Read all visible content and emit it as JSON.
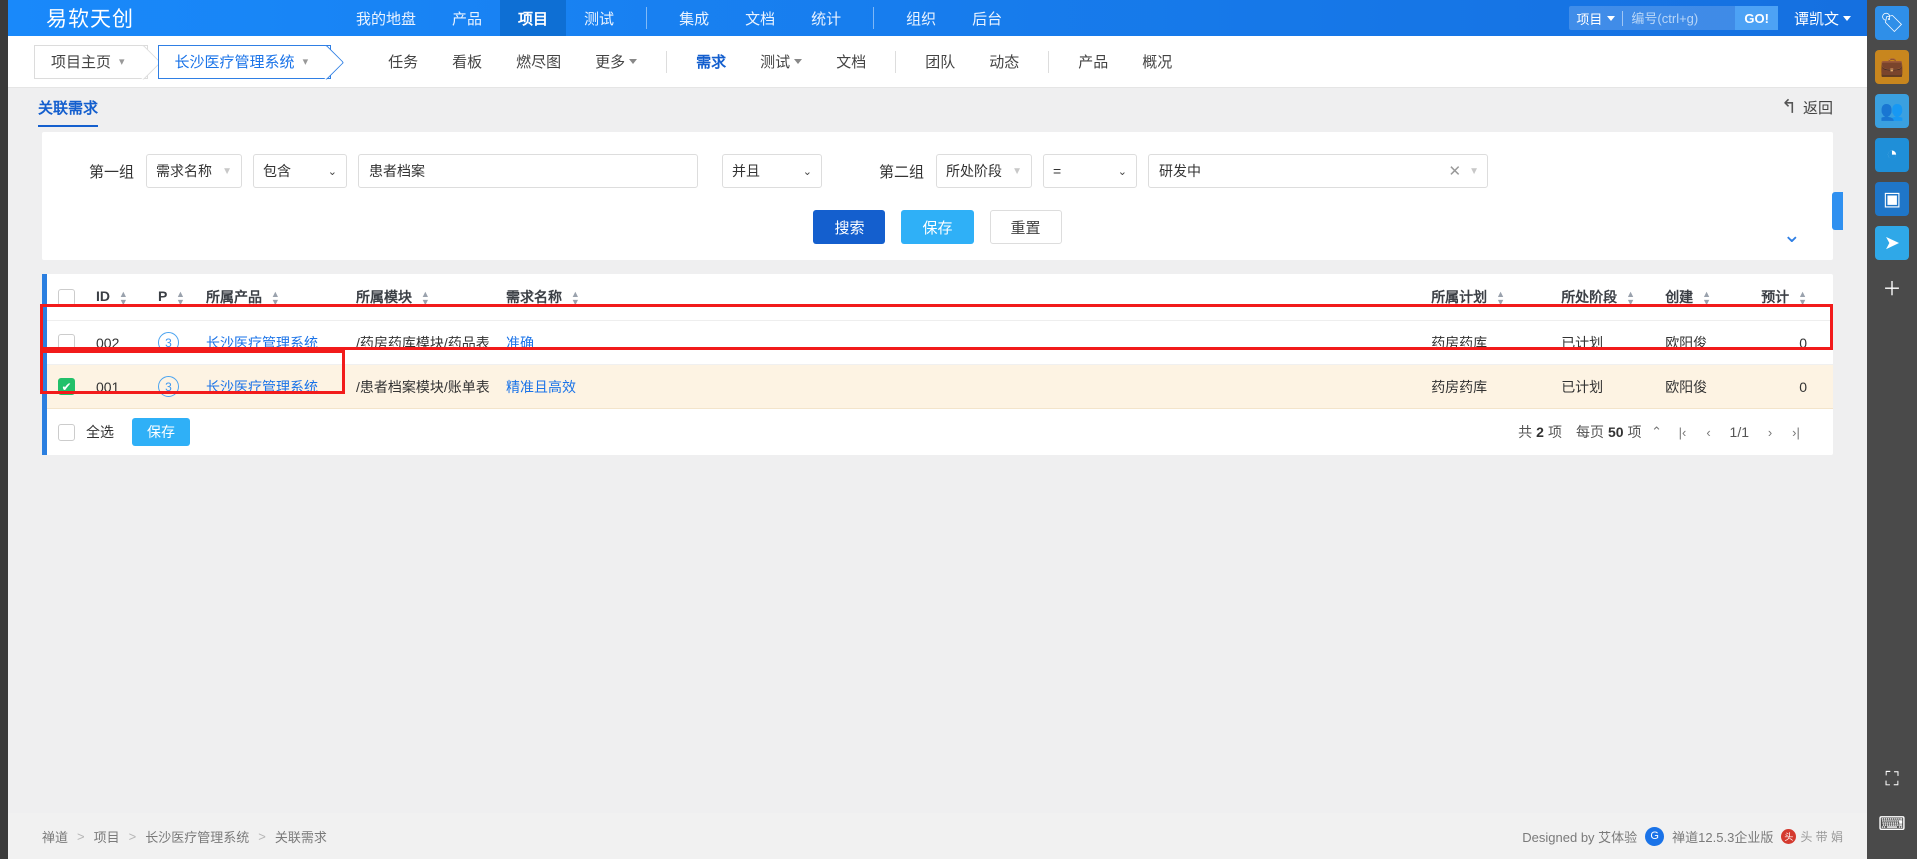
{
  "brand": "易软天创",
  "topnav": {
    "items": [
      {
        "label": "我的地盘",
        "active": false
      },
      {
        "label": "产品",
        "active": false
      },
      {
        "label": "项目",
        "active": true
      },
      {
        "label": "测试",
        "active": false
      },
      {
        "divider": true
      },
      {
        "label": "集成",
        "active": false
      },
      {
        "label": "文档",
        "active": false
      },
      {
        "label": "统计",
        "active": false
      },
      {
        "divider": true
      },
      {
        "label": "组织",
        "active": false
      },
      {
        "label": "后台",
        "active": false
      }
    ],
    "search": {
      "type": "项目",
      "placeholder": "编号(ctrl+g)",
      "value": "",
      "go_label": "GO!"
    },
    "user": "谭凯文"
  },
  "breadcrumbs": [
    {
      "label": "项目主页",
      "type": "plain"
    },
    {
      "label": "长沙医疗管理系统",
      "type": "project"
    }
  ],
  "subnav": {
    "items": [
      {
        "label": "任务",
        "active": false,
        "caret": false
      },
      {
        "label": "看板",
        "active": false,
        "caret": false
      },
      {
        "label": "燃尽图",
        "active": false,
        "caret": false
      },
      {
        "label": "更多",
        "active": false,
        "caret": true
      },
      {
        "divider": true
      },
      {
        "label": "需求",
        "active": true,
        "caret": false
      },
      {
        "label": "测试",
        "active": false,
        "caret": true
      },
      {
        "label": "文档",
        "active": false,
        "caret": false
      },
      {
        "divider": true
      },
      {
        "label": "团队",
        "active": false,
        "caret": false
      },
      {
        "label": "动态",
        "active": false,
        "caret": false
      },
      {
        "divider": true
      },
      {
        "label": "产品",
        "active": false,
        "caret": false
      },
      {
        "label": "概况",
        "active": false,
        "caret": false
      }
    ]
  },
  "page": {
    "tab": "关联需求",
    "back_label": "返回"
  },
  "filters": {
    "group1_label": "第一组",
    "group1_field": "需求名称",
    "group1_operator": "包含",
    "group1_value": "患者档案",
    "group1_value_placeholder": "",
    "conjunction": "并且",
    "group2_label": "第二组",
    "group2_field": "所处阶段",
    "group2_operator": "=",
    "group2_value": "研发中",
    "buttons": {
      "search": "搜索",
      "save": "保存",
      "reset": "重置"
    }
  },
  "table": {
    "columns": [
      {
        "key": "checkbox",
        "label": "",
        "sortable": false
      },
      {
        "key": "id",
        "label": "ID",
        "sortable": true
      },
      {
        "key": "pri",
        "label": "P",
        "sortable": true
      },
      {
        "key": "product",
        "label": "所属产品",
        "sortable": true
      },
      {
        "key": "module",
        "label": "所属模块",
        "sortable": true
      },
      {
        "key": "name",
        "label": "需求名称",
        "sortable": true
      },
      {
        "key": "plan",
        "label": "所属计划",
        "sortable": true
      },
      {
        "key": "stage",
        "label": "所处阶段",
        "sortable": true
      },
      {
        "key": "creator",
        "label": "创建",
        "sortable": true
      },
      {
        "key": "estimate",
        "label": "预计",
        "sortable": true
      }
    ],
    "rows": [
      {
        "checked": false,
        "id": "002",
        "pri": "3",
        "product": "长沙医疗管理系统",
        "module": "/药房药库模块/药品表",
        "name": "准确",
        "plan": "药房药库",
        "stage": "已计划",
        "creator": "欧阳俊",
        "estimate": "0"
      },
      {
        "checked": true,
        "id": "001",
        "pri": "3",
        "product": "长沙医疗管理系统",
        "module": "/患者档案模块/账单表",
        "name": "精准且高效",
        "plan": "药房药库",
        "stage": "已计划",
        "creator": "欧阳俊",
        "estimate": "0"
      }
    ],
    "footer": {
      "select_all_label": "全选",
      "save_label": "保存",
      "total_prefix": "共",
      "total_count": "2",
      "total_suffix": "项",
      "per_page_prefix": "每页",
      "per_page": "50",
      "per_page_suffix": "项",
      "page_indicator": "1/1"
    }
  },
  "footer": {
    "breadcrumb": [
      "禅道",
      "项目",
      "长沙医疗管理系统",
      "关联需求"
    ],
    "designed_by": "Designed by 艾体验",
    "version": "禅道12.5.3企业版",
    "watermark": "头 带 娟"
  },
  "colors": {
    "brand_blue": "#1989fa",
    "accent_blue": "#145fce",
    "link_blue": "#1a73e8",
    "info_blue": "#2fb0f7",
    "check_green": "#22c06a",
    "selected_row": "#fdf3e3",
    "annotation_red": "#f21b1b"
  },
  "icons": {
    "back": "back-arrow-icon",
    "more": "chevron-double-down-icon",
    "rail": [
      "tag-icon",
      "briefcase-icon",
      "people-icon",
      "pie-chart-icon",
      "camera-icon",
      "send-icon",
      "plus-icon",
      "screenshot-icon",
      "keyboard-icon"
    ]
  }
}
